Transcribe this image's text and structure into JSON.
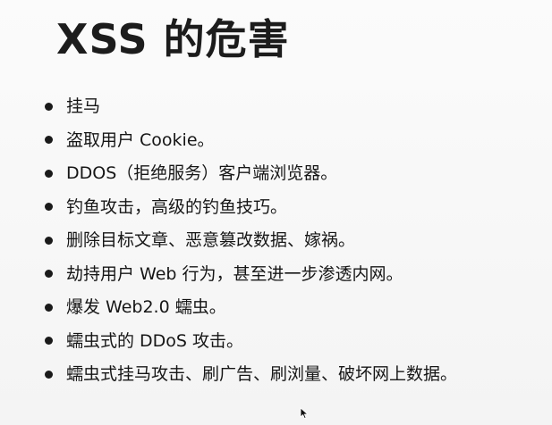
{
  "slide": {
    "title": "XSS 的危害",
    "bullets": [
      "挂马",
      "盗取用户 Cookie。",
      "DDOS（拒绝服务）客户端浏览器。",
      "钓鱼攻击，高级的钓鱼技巧。",
      "删除目标文章、恶意篡改数据、嫁祸。",
      "劫持用户 Web 行为，甚至进一步渗透内网。",
      "爆发 Web2.0 蠕虫。",
      "蠕虫式的 DDoS 攻击。",
      "蠕虫式挂马攻击、刷广告、刷浏量、破坏网上数据。"
    ]
  },
  "icons": {
    "cursor": "mouse-pointer-icon"
  }
}
